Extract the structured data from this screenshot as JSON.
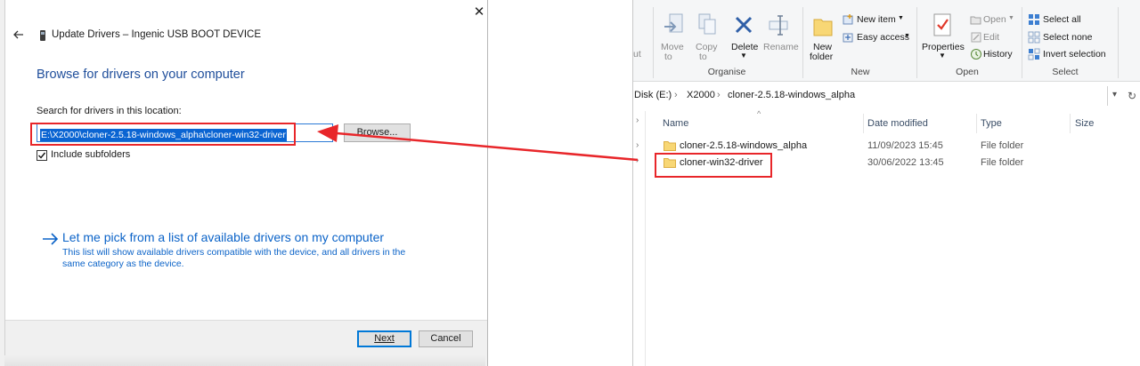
{
  "dialog": {
    "title": "Update Drivers – Ingenic USB BOOT DEVICE",
    "heading": "Browse for drivers on your computer",
    "search_label": "Search for drivers in this location:",
    "path_value": "E:\\X2000\\cloner-2.5.18-windows_alpha\\cloner-win32-driver",
    "browse_label": "Browse...",
    "include_subfolders_label": "Include subfolders",
    "include_subfolders_checked": true,
    "pick_link": "Let me pick from a list of available drivers on my computer",
    "pick_desc": "This list will show available drivers compatible with the device, and all drivers in the same category as the device.",
    "next_label": "Next",
    "cancel_label": "Cancel",
    "close_glyph": "✕"
  },
  "explorer": {
    "ribbon": {
      "cut_fragment": "ut",
      "move_to": [
        "Move",
        "to"
      ],
      "copy_to": [
        "Copy",
        "to"
      ],
      "delete": "Delete",
      "rename": "Rename",
      "new_folder": [
        "New",
        "folder"
      ],
      "new_item": "New item",
      "easy_access": "Easy access",
      "properties": "Properties",
      "open": "Open",
      "edit": "Edit",
      "history": "History",
      "select_all": "Select all",
      "select_none": "Select none",
      "invert_selection": "Invert selection",
      "groups": {
        "organise": "Organise",
        "new": "New",
        "open": "Open",
        "select": "Select"
      }
    },
    "address": {
      "segments": [
        "Disk (E:)",
        "X2000",
        "cloner-2.5.18-windows_alpha"
      ],
      "separator": "›"
    },
    "columns": {
      "name": "Name",
      "date": "Date modified",
      "type": "Type",
      "size": "Size"
    },
    "rows": [
      {
        "name": "cloner-2.5.18-windows_alpha",
        "date": "11/09/2023 15:45",
        "type": "File folder"
      },
      {
        "name": "cloner-win32-driver",
        "date": "30/06/2022 13:45",
        "type": "File folder"
      }
    ]
  },
  "colors": {
    "annotation": "#e8262a",
    "heading_blue": "#1f4e9b",
    "link_blue": "#0b63c8",
    "selection": "#0a64d2",
    "folder": "#f8d775"
  }
}
